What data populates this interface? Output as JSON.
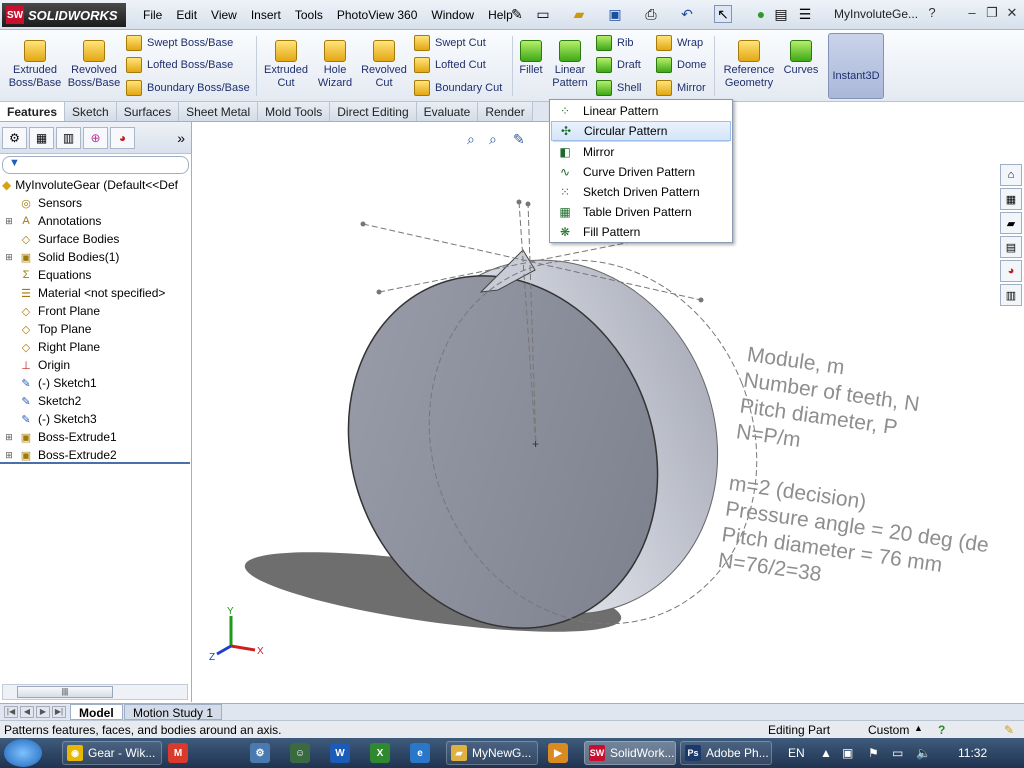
{
  "app": {
    "logo": "SOLIDWORKS",
    "doc_title": "MyInvoluteGe..."
  },
  "menu": [
    "File",
    "Edit",
    "View",
    "Insert",
    "Tools",
    "PhotoView 360",
    "Window",
    "Help"
  ],
  "commands": {
    "extruded_boss": "Extruded Boss/Base",
    "revolved_boss": "Revolved Boss/Base",
    "swept_boss": "Swept Boss/Base",
    "lofted_boss": "Lofted Boss/Base",
    "boundary_boss": "Boundary Boss/Base",
    "extruded_cut": "Extruded Cut",
    "hole_wizard": "Hole Wizard",
    "revolved_cut": "Revolved Cut",
    "swept_cut": "Swept Cut",
    "lofted_cut": "Lofted Cut",
    "boundary_cut": "Boundary Cut",
    "fillet": "Fillet",
    "linear_pattern": "Linear Pattern",
    "rib": "Rib",
    "draft": "Draft",
    "shell": "Shell",
    "wrap": "Wrap",
    "dome": "Dome",
    "mirror": "Mirror",
    "reference_geometry": "Reference Geometry",
    "curves": "Curves",
    "instant3d": "Instant3D"
  },
  "tabs": [
    "Features",
    "Sketch",
    "Surfaces",
    "Sheet Metal",
    "Mold Tools",
    "Direct Editing",
    "Evaluate",
    "Render"
  ],
  "tree": {
    "root": "MyInvoluteGear  (Default<<Def",
    "items": [
      {
        "label": "Sensors",
        "icon": "sensor-icon",
        "expand": false
      },
      {
        "label": "Annotations",
        "icon": "annotations-icon",
        "expand": true
      },
      {
        "label": "Surface Bodies",
        "icon": "surface-bodies-icon",
        "expand": false
      },
      {
        "label": "Solid Bodies(1)",
        "icon": "solid-bodies-icon",
        "expand": true
      },
      {
        "label": "Equations",
        "icon": "equations-icon",
        "expand": false
      },
      {
        "label": "Material <not specified>",
        "icon": "material-icon",
        "expand": false
      },
      {
        "label": "Front Plane",
        "icon": "plane-icon",
        "expand": false
      },
      {
        "label": "Top Plane",
        "icon": "plane-icon",
        "expand": false
      },
      {
        "label": "Right Plane",
        "icon": "plane-icon",
        "expand": false
      },
      {
        "label": "Origin",
        "icon": "origin-icon",
        "expand": false
      },
      {
        "label": "(-) Sketch1",
        "icon": "sketch-icon",
        "expand": false
      },
      {
        "label": "Sketch2",
        "icon": "sketch-icon",
        "expand": false
      },
      {
        "label": "(-) Sketch3",
        "icon": "sketch-icon",
        "expand": false
      },
      {
        "label": "Boss-Extrude1",
        "icon": "extrude-icon",
        "expand": true
      },
      {
        "label": "Boss-Extrude2",
        "icon": "extrude-icon",
        "expand": true
      }
    ]
  },
  "dropdown": {
    "options": [
      {
        "label": "Linear Pattern",
        "icon": "linear-pattern-icon",
        "selected": false
      },
      {
        "label": "Circular Pattern",
        "icon": "circular-pattern-icon",
        "selected": true
      },
      {
        "label": "Mirror",
        "icon": "mirror-icon",
        "selected": false
      },
      {
        "label": "Curve Driven Pattern",
        "icon": "curve-driven-pattern-icon",
        "selected": false
      },
      {
        "label": "Sketch Driven Pattern",
        "icon": "sketch-driven-pattern-icon",
        "selected": false
      },
      {
        "label": "Table Driven Pattern",
        "icon": "table-driven-pattern-icon",
        "selected": false
      },
      {
        "label": "Fill Pattern",
        "icon": "fill-pattern-icon",
        "selected": false
      }
    ]
  },
  "notes": [
    "Module, m",
    "Number of teeth, N",
    "Pitch diameter, P",
    "N=P/m",
    "",
    "m=2 (decision)",
    "Pressure angle = 20 deg (de",
    "Pitch diameter = 76 mm",
    "N=76/2=38"
  ],
  "triad": {
    "x": "X",
    "y": "Y",
    "z": "Z"
  },
  "bottom_tabs": [
    "Model",
    "Motion Study 1"
  ],
  "status": {
    "message": "Patterns features, faces, and bodies around an axis.",
    "mode": "Editing Part",
    "units": "Custom"
  },
  "taskbar": {
    "apps": [
      {
        "label": "Gear - Wik...",
        "icon": "chrome-icon",
        "color": "#e6b800",
        "active": false
      },
      {
        "label": "MyNewG...",
        "icon": "folder-icon",
        "color": "#e0b040",
        "active": false
      },
      {
        "label": "SolidWork...",
        "icon": "solidworks-icon",
        "color": "#c8102e",
        "active": true
      },
      {
        "label": "Adobe Ph...",
        "icon": "photoshop-icon",
        "color": "#1b3a6b",
        "active": false
      }
    ],
    "lang": "EN",
    "time": "11:32"
  },
  "colors": {
    "accent": "#1f2f6e",
    "gear_face": "#8a8d99",
    "selection": "#d4e4f8"
  }
}
